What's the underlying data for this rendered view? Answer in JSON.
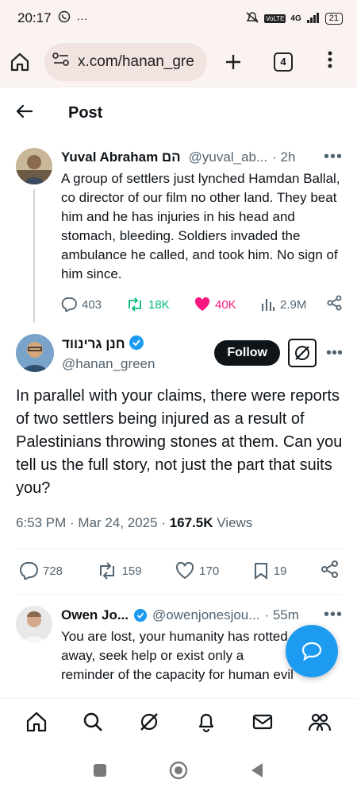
{
  "status_bar": {
    "time": "20:17",
    "network": "4G",
    "battery": "21"
  },
  "browser": {
    "url": "x.com/hanan_gre",
    "tab_count": "4"
  },
  "header": {
    "title": "Post"
  },
  "parent_tweet": {
    "author_name": "Yuval Abraham יובל אברהם",
    "display_name": "Yuval Abraham הם",
    "handle": "@yuval_ab...",
    "time": "· 2h",
    "text": "A group of settlers just lynched Hamdan Ballal, co director of our film no other land. They beat him and he has injuries in his head and stomach, bleeding. Soldiers invaded the ambulance he called, and took him. No sign of him since.",
    "replies": "403",
    "reposts": "18K",
    "likes": "40K",
    "views": "2.9M"
  },
  "main_tweet": {
    "display_name": "חנן גרינווד",
    "handle": "@hanan_green",
    "follow_label": "Follow",
    "text": "In parallel with your claims, there were reports of two settlers being injured as a result of Palestinians throwing stones at them. Can you tell us the full story, not just the part that suits you?",
    "timestamp": "6:53 PM · Mar 24, 2025 · ",
    "views_count": "167.5K",
    "views_label": " Views",
    "replies": "728",
    "reposts": "159",
    "likes": "170",
    "bookmarks": "19"
  },
  "reply_tweet": {
    "display_name": "Owen Jo...",
    "handle": "@owenjonesjou...",
    "time": "· 55m",
    "text": "You are lost, your humanity has rotted away, seek help or exist only a reminder of the capacity for human evil"
  },
  "colors": {
    "accent": "#1d9bf0",
    "repost_green": "#00ba7c",
    "like_pink": "#f91880",
    "text_muted": "#536471"
  }
}
